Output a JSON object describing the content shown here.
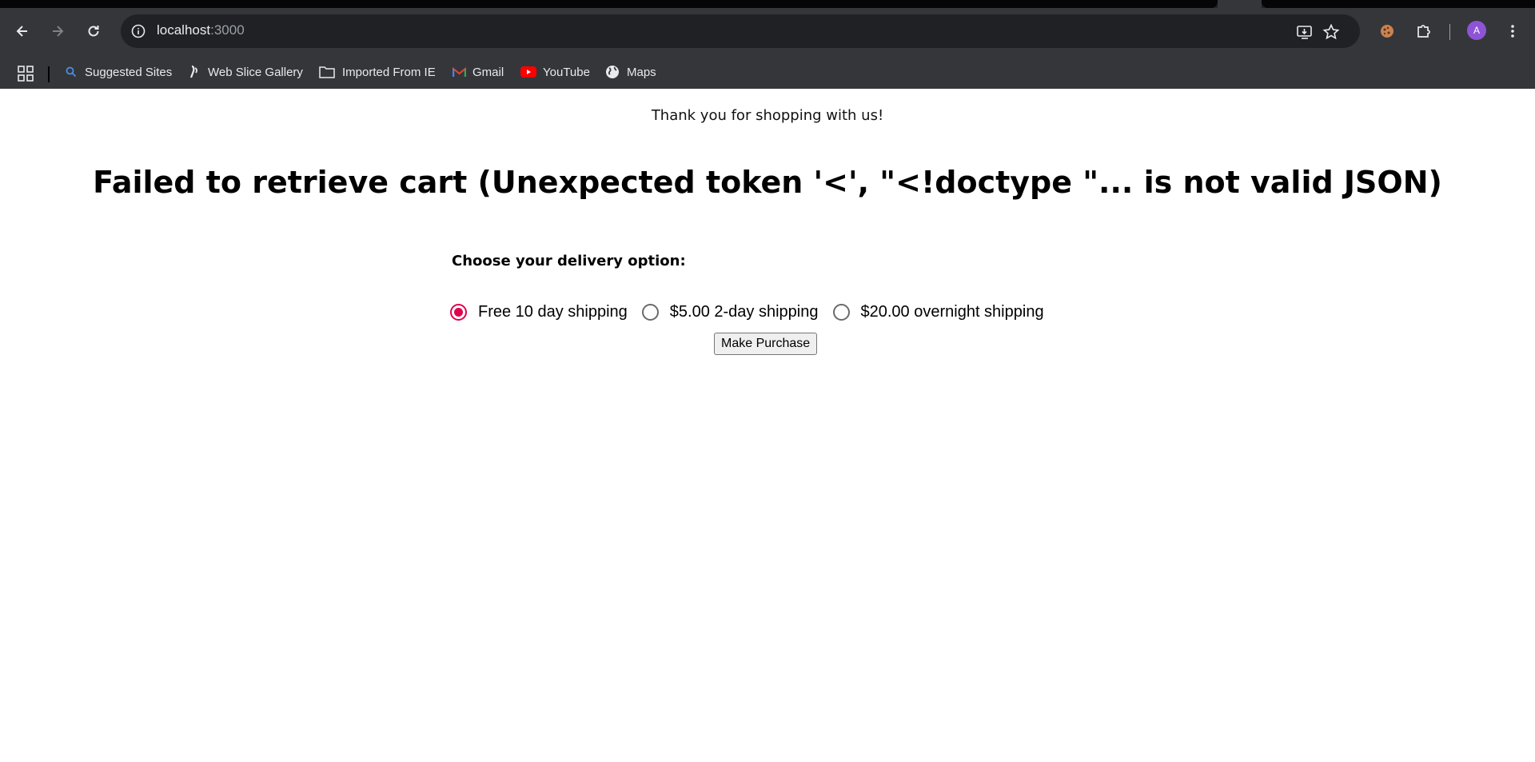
{
  "browser": {
    "url_host": "localhost",
    "url_port": ":3000",
    "profile_initial": "A",
    "accent_avatar": "#8e54d6",
    "bookmarks": [
      {
        "label": "Suggested Sites",
        "icon": "search-icon"
      },
      {
        "label": "Web Slice Gallery",
        "icon": "web-slice-icon"
      },
      {
        "label": "Imported From IE",
        "icon": "folder-icon"
      },
      {
        "label": "Gmail",
        "icon": "gmail-icon"
      },
      {
        "label": "YouTube",
        "icon": "youtube-icon"
      },
      {
        "label": "Maps",
        "icon": "globe-icon"
      }
    ]
  },
  "page": {
    "thanks_text": "Thank you for shopping with us!",
    "error_heading": "Failed to retrieve cart (Unexpected token '<', \"<!doctype \"... is not valid JSON)",
    "delivery_label": "Choose your delivery option:",
    "options": [
      {
        "label": "Free 10 day shipping",
        "checked": true
      },
      {
        "label": "$5.00 2-day shipping",
        "checked": false
      },
      {
        "label": "$20.00 overnight shipping",
        "checked": false
      }
    ],
    "purchase_button": "Make Purchase",
    "radio_accent": "#e0044f"
  }
}
